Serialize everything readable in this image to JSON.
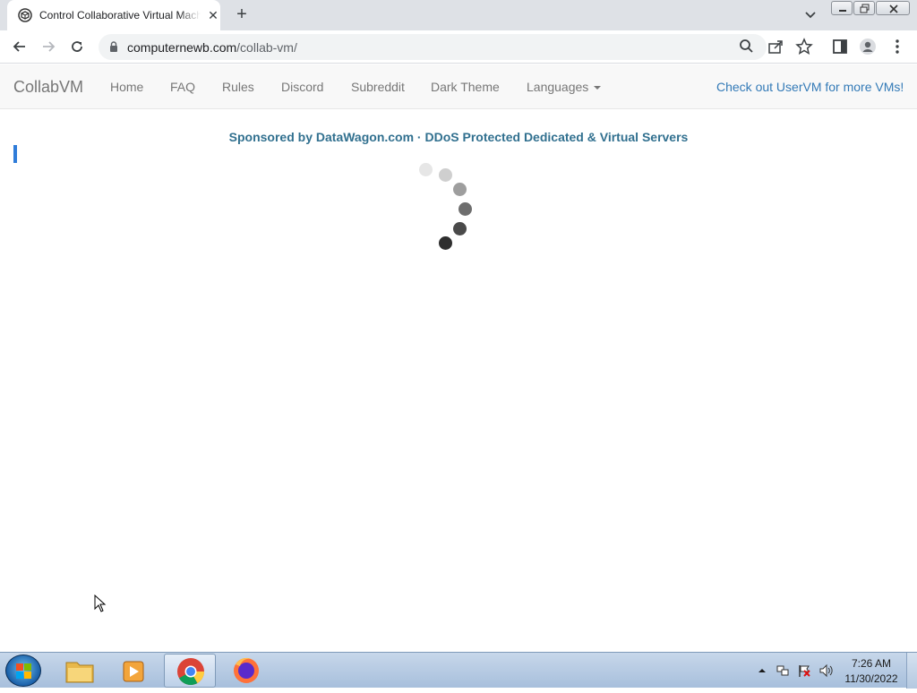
{
  "browser": {
    "tab_title": "Control Collaborative Virtual Machines",
    "tab_close_glyph": "✕",
    "new_tab_glyph": "+",
    "url_host": "computernewb.com",
    "url_path": "/collab-vm/"
  },
  "navbar": {
    "brand": "CollabVM",
    "links": [
      "Home",
      "FAQ",
      "Rules",
      "Discord",
      "Subreddit",
      "Dark Theme"
    ],
    "languages": "Languages",
    "right_link": "Check out UserVM for more VMs!"
  },
  "page": {
    "sponsor_text": "Sponsored by DataWagon.com · DDoS Protected Dedicated & Virtual Servers"
  },
  "taskbar": {
    "time": "7:26 AM",
    "date": "11/30/2022"
  },
  "colors": {
    "accent_link": "#337ab7",
    "sponsor": "#31708f",
    "indicator_bar": "#2f7cd9"
  }
}
